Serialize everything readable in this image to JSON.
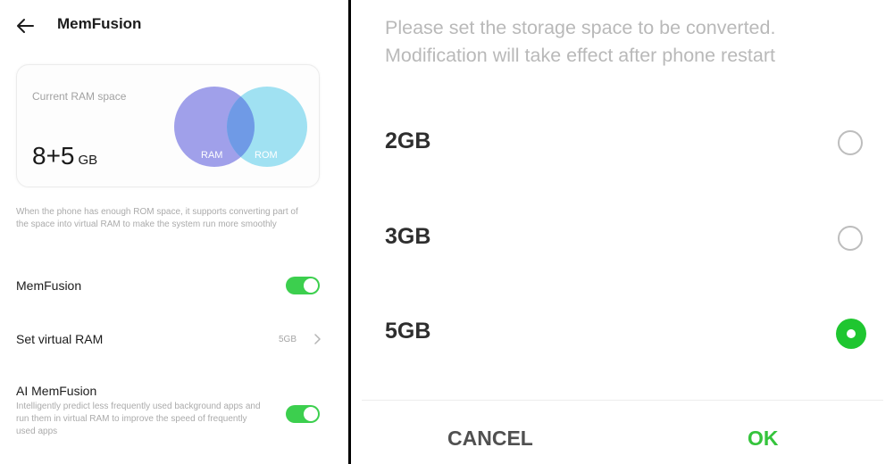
{
  "memfusion_screen": {
    "title": "MemFusion",
    "ram_card": {
      "label": "Current RAM space",
      "value": "8+5",
      "unit": "GB",
      "venn": {
        "left_label": "RAM",
        "right_label": "ROM"
      }
    },
    "description": "When the phone has enough ROM space, it supports converting part of the space into virtual RAM to make the system run more smoothly",
    "settings": {
      "memfusion": {
        "label": "MemFusion",
        "enabled": true
      },
      "virtual_ram": {
        "label": "Set virtual RAM",
        "value": "5GB"
      },
      "ai_memfusion": {
        "label": "AI MemFusion",
        "description": "Intelligently predict less frequently used background apps and run them in virtual RAM to improve the speed of frequently used apps",
        "enabled": true
      }
    }
  },
  "dialog": {
    "message": "Please set the storage space to be converted. Modification will take effect after phone restart",
    "options": [
      {
        "label": "2GB",
        "selected": false
      },
      {
        "label": "3GB",
        "selected": false
      },
      {
        "label": "5GB",
        "selected": true
      }
    ],
    "cancel_label": "CANCEL",
    "ok_label": "OK"
  },
  "colors": {
    "accent_green": "#3ccf4e",
    "ok_green": "#35c43c",
    "radio_green": "#1fc630",
    "venn_ram": "#8f8fe6",
    "venn_rom": "#8fdcf0",
    "venn_overlap": "#6f9ae6"
  },
  "icons": {
    "back": "arrow-left-icon",
    "row_chevron": "chevron-right-icon"
  }
}
